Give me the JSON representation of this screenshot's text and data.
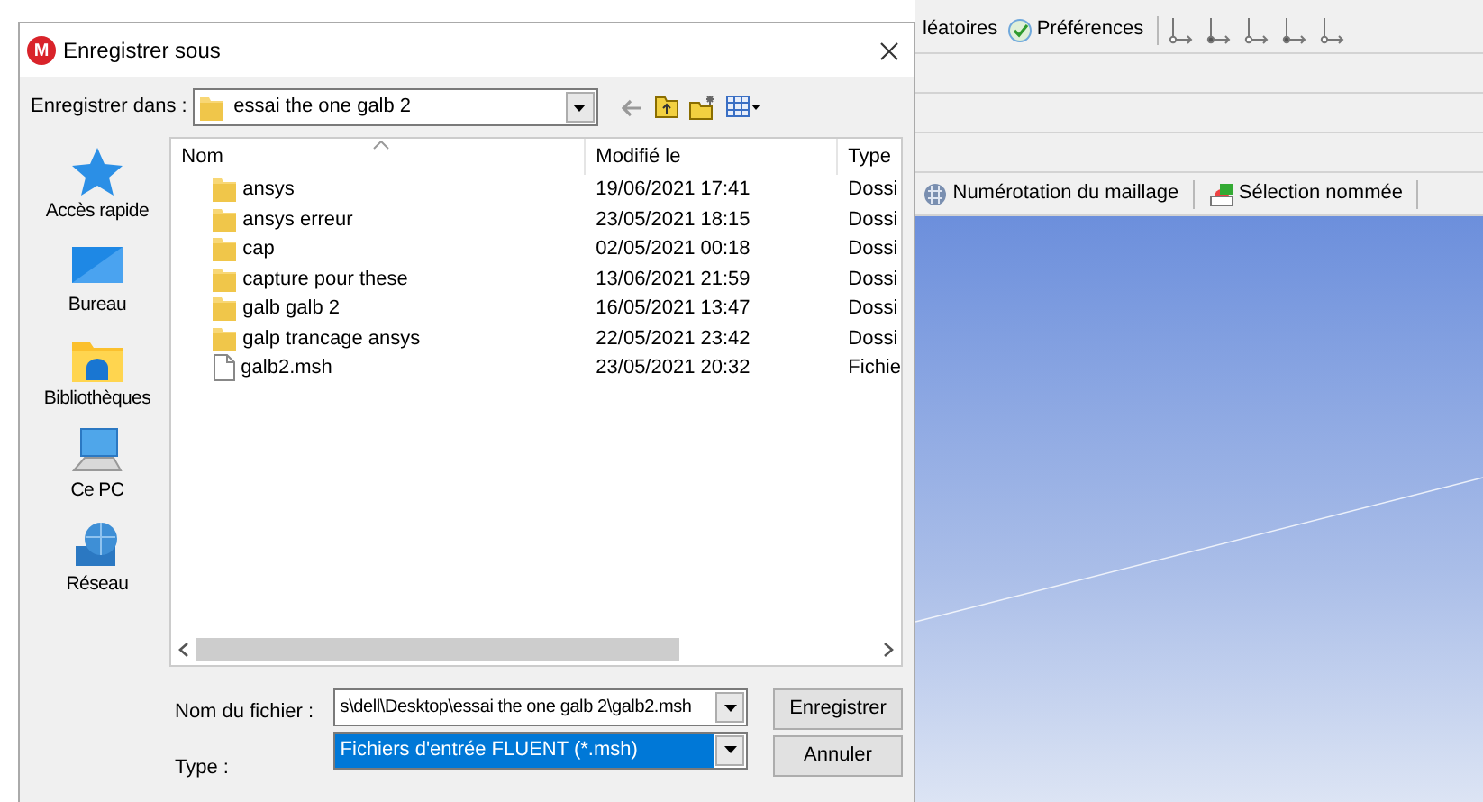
{
  "dialog": {
    "logo_letter": "M",
    "title": "Enregistrer sous",
    "save_in_label": "Enregistrer dans :",
    "save_in_value": "essai the one galb 2",
    "places": [
      {
        "kind": "star",
        "label": "Accès rapide"
      },
      {
        "kind": "desktop",
        "label": "Bureau"
      },
      {
        "kind": "library",
        "label": "Bibliothèques"
      },
      {
        "kind": "pc",
        "label": "Ce PC"
      },
      {
        "kind": "network",
        "label": "Réseau"
      }
    ],
    "columns": [
      "Nom",
      "Modifié le",
      "Type"
    ],
    "files": [
      {
        "kind": "folder",
        "name": "ansys",
        "modified": "19/06/2021 17:41",
        "type": "Dossi"
      },
      {
        "kind": "folder",
        "name": "ansys erreur",
        "modified": "23/05/2021 18:15",
        "type": "Dossi"
      },
      {
        "kind": "folder",
        "name": "cap",
        "modified": "02/05/2021 00:18",
        "type": "Dossi"
      },
      {
        "kind": "folder",
        "name": "capture pour these",
        "modified": "13/06/2021 21:59",
        "type": "Dossi"
      },
      {
        "kind": "folder",
        "name": "galb galb 2",
        "modified": "16/05/2021 13:47",
        "type": "Dossi"
      },
      {
        "kind": "folder",
        "name": "galp trancage ansys",
        "modified": "22/05/2021 23:42",
        "type": "Dossi"
      },
      {
        "kind": "file",
        "name": "galb2.msh",
        "modified": "23/05/2021 20:32",
        "type": "Fichie"
      }
    ],
    "filename_label": "Nom du fichier :",
    "filename_value": "s\\dell\\Desktop\\essai the one galb 2\\galb2.msh",
    "type_label": "Type :",
    "type_value": "Fichiers d'entrée FLUENT (*.msh)",
    "type_highlighted": true,
    "buttons": [
      "Enregistrer",
      "Annuler"
    ]
  },
  "background_app": {
    "toolbar": [
      {
        "kind": "plain",
        "label": "léatoires"
      },
      {
        "kind": "check",
        "label": "Préférences"
      }
    ],
    "toolbar_2": [
      {
        "kind": "mesh",
        "label": "Numérotation du maillage"
      },
      {
        "kind": "selection",
        "label": "Sélection nommée"
      }
    ]
  }
}
